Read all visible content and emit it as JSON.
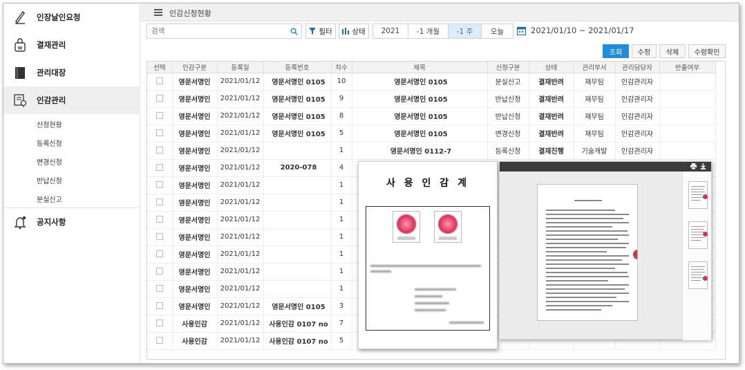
{
  "sidebar": {
    "items": [
      {
        "label": "인장날인요청"
      },
      {
        "label": "결재관리"
      },
      {
        "label": "관리대장"
      },
      {
        "label": "인감관리"
      },
      {
        "label": "공지사항"
      }
    ],
    "submenu": [
      "신청현황",
      "등록신청",
      "변경신청",
      "반납신청",
      "분실신고"
    ]
  },
  "header": {
    "title": "인감신청현황"
  },
  "toolbar": {
    "search_placeholder": "검색",
    "filter_label": "필터",
    "status_label": "상태",
    "periods": [
      "2021",
      "-1 개월",
      "-1 주",
      "오늘"
    ],
    "selected_period": "-1 주",
    "date_range": "2021/01/10 ~ 2021/01/17"
  },
  "actions": {
    "query": "조회",
    "edit": "수정",
    "delete": "삭제",
    "receive": "수령확인"
  },
  "table": {
    "columns": [
      "선택",
      "인감구분",
      "등록일",
      "등록번호",
      "차수",
      "제목",
      "신청구분",
      "상태",
      "관리부서",
      "관리담당자",
      "반출여부"
    ],
    "rows": [
      {
        "type": "영문서명인",
        "date": "2021/01/12",
        "reg_no": "영문서명인 0105",
        "seq": "10",
        "title": "영문서명인 0105",
        "req": "분실신고",
        "status": "결재반려",
        "dept": "재무팀",
        "manager": "인감관리자",
        "out": ""
      },
      {
        "type": "영문서명인",
        "date": "2021/01/12",
        "reg_no": "영문서명인 0105",
        "seq": "9",
        "title": "영문서명인 0105",
        "req": "반납신청",
        "status": "결재반려",
        "dept": "재무팀",
        "manager": "인감관리자",
        "out": ""
      },
      {
        "type": "영문서명인",
        "date": "2021/01/12",
        "reg_no": "영문서명인 0105",
        "seq": "8",
        "title": "영문서명인 0105",
        "req": "반납신청",
        "status": "결재반려",
        "dept": "재무팀",
        "manager": "인감관리자",
        "out": ""
      },
      {
        "type": "영문서명인",
        "date": "2021/01/12",
        "reg_no": "영문서명인 0105",
        "seq": "5",
        "title": "영문서명인 0105",
        "req": "변경신청",
        "status": "결재반려",
        "dept": "재무팀",
        "manager": "인감관리자",
        "out": ""
      },
      {
        "type": "영문서명인",
        "date": "2021/01/12",
        "reg_no": "",
        "seq": "1",
        "title": "영문서명인 0112-7",
        "req": "등록신청",
        "status": "결재진행",
        "dept": "기술개발",
        "manager": "인감관리자",
        "out": ""
      },
      {
        "type": "영문서명인",
        "date": "2021/01/12",
        "reg_no": "2020-078",
        "seq": "4",
        "title": "",
        "req": "",
        "status": "",
        "dept": "",
        "manager": "",
        "out": ""
      },
      {
        "type": "영문서명인",
        "date": "2021/01/12",
        "reg_no": "",
        "seq": "1",
        "title": "",
        "req": "",
        "status": "",
        "dept": "",
        "manager": "",
        "out": ""
      },
      {
        "type": "영문서명인",
        "date": "2021/01/12",
        "reg_no": "",
        "seq": "1",
        "title": "",
        "req": "",
        "status": "",
        "dept": "",
        "manager": "",
        "out": ""
      },
      {
        "type": "영문서명인",
        "date": "2021/01/12",
        "reg_no": "",
        "seq": "1",
        "title": "",
        "req": "",
        "status": "",
        "dept": "",
        "manager": "",
        "out": ""
      },
      {
        "type": "영문서명인",
        "date": "2021/01/12",
        "reg_no": "",
        "seq": "1",
        "title": "",
        "req": "",
        "status": "",
        "dept": "",
        "manager": "",
        "out": ""
      },
      {
        "type": "영문서명인",
        "date": "2021/01/12",
        "reg_no": "",
        "seq": "1",
        "title": "",
        "req": "",
        "status": "",
        "dept": "",
        "manager": "",
        "out": ""
      },
      {
        "type": "영문서명인",
        "date": "2021/01/12",
        "reg_no": "",
        "seq": "1",
        "title": "",
        "req": "",
        "status": "",
        "dept": "",
        "manager": "",
        "out": ""
      },
      {
        "type": "영문서명인",
        "date": "2021/01/12",
        "reg_no": "",
        "seq": "1",
        "title": "",
        "req": "",
        "status": "",
        "dept": "",
        "manager": "",
        "out": ""
      },
      {
        "type": "영문서명인",
        "date": "2021/01/12",
        "reg_no": "영문서명인 0105",
        "seq": "3",
        "title": "",
        "req": "",
        "status": "",
        "dept": "",
        "manager": "",
        "out": ""
      },
      {
        "type": "사용인감",
        "date": "2021/01/12",
        "reg_no": "사용인감 0107 no",
        "seq": "7",
        "title": "",
        "req": "",
        "status": "",
        "dept": "",
        "manager": "",
        "out": ""
      },
      {
        "type": "사용인감",
        "date": "2021/01/12",
        "reg_no": "사용인감 0107 no",
        "seq": "5",
        "title": "",
        "req": "",
        "status": "",
        "dept": "",
        "manager": "",
        "out": ""
      }
    ]
  },
  "popup_seal": {
    "title": "사 용 인 감 계"
  },
  "colors": {
    "accent": "#1e8de0",
    "status_link": "#2b63a8",
    "seal_red": "#e23b63"
  },
  "icons": [
    "pen-icon",
    "approval-bag-icon",
    "ledger-book-icon",
    "seal-management-icon",
    "bell-icon",
    "search-icon",
    "filter-icon",
    "status-bars-icon",
    "calendar-icon",
    "print-icon",
    "download-icon"
  ]
}
